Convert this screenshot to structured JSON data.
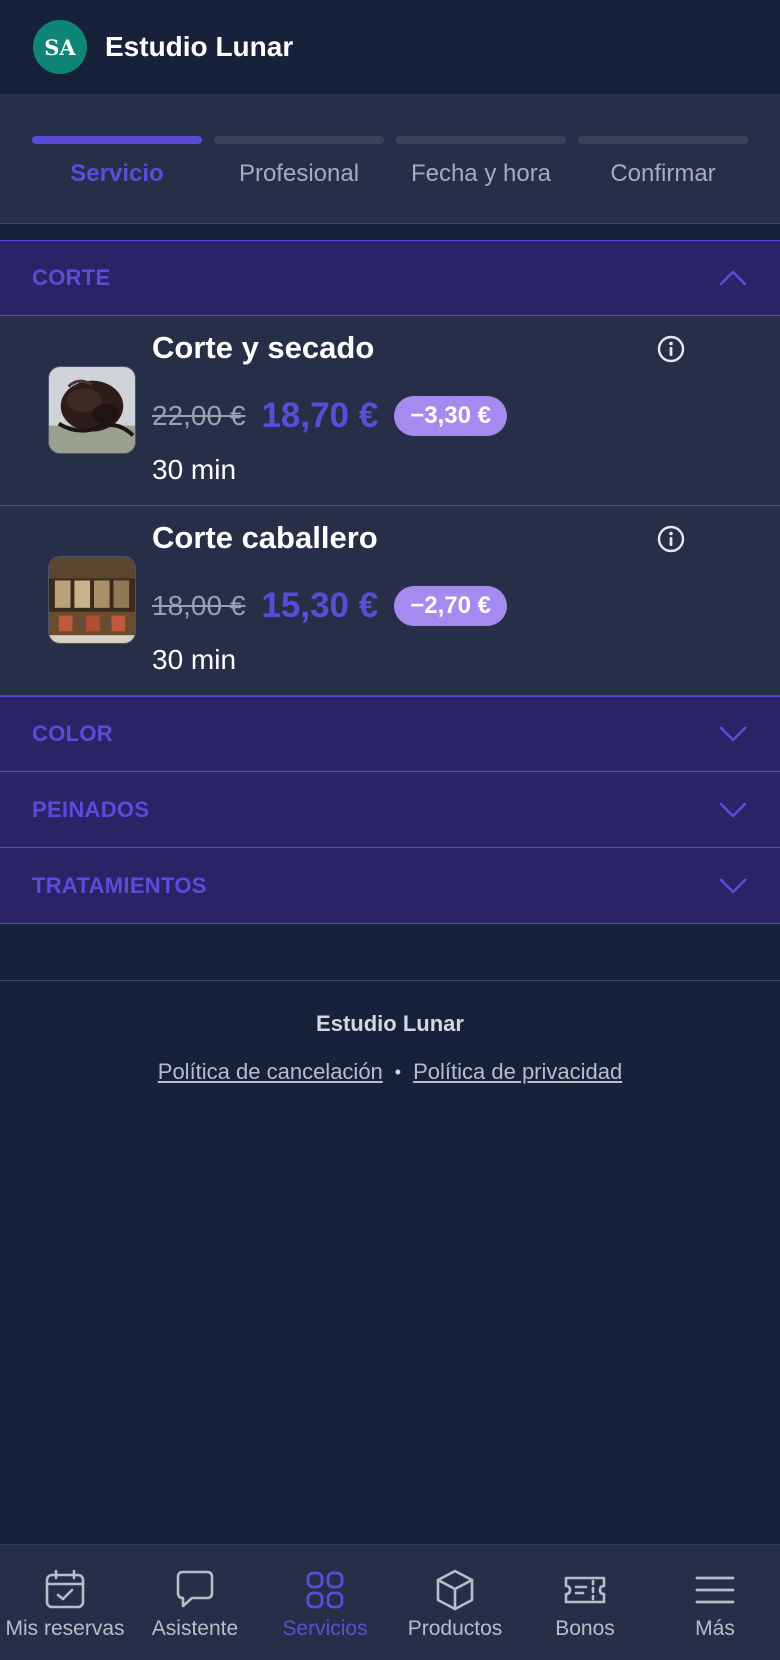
{
  "header": {
    "avatar_text": "SA",
    "title": "Estudio Lunar",
    "avatar_color": "#0f8577"
  },
  "steps": [
    {
      "label": "Servicio",
      "active": true
    },
    {
      "label": "Profesional",
      "active": false
    },
    {
      "label": "Fecha y hora",
      "active": false
    },
    {
      "label": "Confirmar",
      "active": false
    }
  ],
  "categories": [
    {
      "label": "CORTE",
      "expanded": true,
      "services": [
        {
          "name": "Corte y secado",
          "old_price": "22,00 €",
          "new_price": "18,70 €",
          "discount": "−3,30 €",
          "duration": "30 min",
          "icon": "info-icon"
        },
        {
          "name": "Corte caballero",
          "old_price": "18,00 €",
          "new_price": "15,30 €",
          "discount": "−2,70 €",
          "duration": "30 min",
          "icon": "info-icon"
        }
      ]
    },
    {
      "label": "COLOR",
      "expanded": false
    },
    {
      "label": "PEINADOS",
      "expanded": false
    },
    {
      "label": "TRATAMIENTOS",
      "expanded": false
    }
  ],
  "footer": {
    "brand": "Estudio Lunar",
    "links": [
      "Política de cancelación",
      "Política de privacidad"
    ],
    "separator": "•"
  },
  "bottom_nav": [
    {
      "label": "Mis reservas",
      "icon": "calendar-icon",
      "active": false
    },
    {
      "label": "Asistente",
      "icon": "chat-bubble-icon",
      "active": false
    },
    {
      "label": "Servicios",
      "icon": "grid-icon",
      "active": true
    },
    {
      "label": "Productos",
      "icon": "box-icon",
      "active": false
    },
    {
      "label": "Bonos",
      "icon": "ticket-icon",
      "active": false
    },
    {
      "label": "Más",
      "icon": "menu-icon",
      "active": false
    }
  ],
  "colors": {
    "background": "#18213a",
    "surface": "#262f47",
    "accent": "#5b4bd8",
    "category_bg": "#2a2466",
    "discount_badge": "#a58af0"
  }
}
